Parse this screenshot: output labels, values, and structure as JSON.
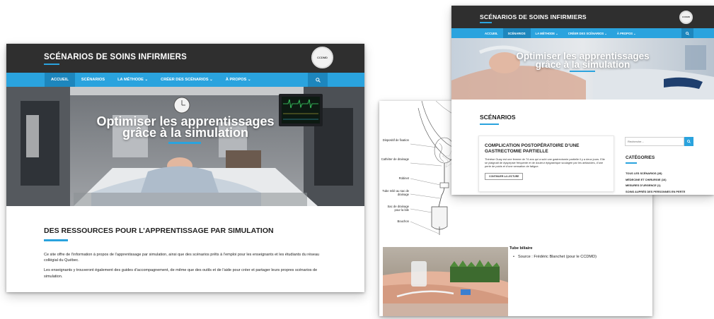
{
  "site": {
    "title": "SCÉNARIOS DE SOINS INFIRMIERS",
    "logo_text": "CCDMD"
  },
  "nav": {
    "items": [
      "ACCUEIL",
      "SCÉNARIOS",
      "LA MÉTHODE ⌄",
      "CRÉER DES SCÉNARIOS ⌄",
      "À PROPOS ⌄"
    ],
    "active_home": 0,
    "active_scenarios": 1
  },
  "hero": {
    "line1": "Optimiser les apprentissages",
    "line2": "grâce à la simulation"
  },
  "home": {
    "heading": "DES RESSOURCES POUR L’APPRENTISSAGE PAR SIMULATION",
    "para1": "Ce site offre de l’information à propos de l’apprentissage par simulation, ainsi que des scénarios prêts à l’emploi pour les enseignants et les étudiants du réseau collégial du Québec.",
    "para2": "Les enseignants y trouveront également des guides d’accompagnement, de même que des outils et de l’aide pour créer et partager leurs propres scénarios de simulation."
  },
  "detail": {
    "diagram_labels": [
      "Dispositif de fixation",
      "Cathéter de drainage",
      "Robinet",
      "Tube relié au sac de drainage",
      "Sac de drainage pour la bile",
      "Bouchon"
    ],
    "tube_title": "Tube biliaire",
    "tube_source": "Source : Frédéric Blanchet (pour le CCDMD)"
  },
  "scenarios": {
    "heading": "SCÉNARIOS",
    "card_title": "COMPLICATION POSTOPÉRATOIRE D’UNE GASTRECTOMIE PARTIELLE",
    "card_text": "Thérèse Guay est une femme de 74 ans qui a subi une gastrectomie partielle il y a deux jours. Elle se plaignait de dyspepsie fréquente et de douleur épigastrique soulagée par les antiacides, d’une perte de poids et d’une sensation de fatigue.",
    "card_button": "CONTINUER LA LECTURE",
    "search_placeholder": "Recherche…",
    "categories_heading": "CATÉGORIES",
    "categories": [
      "TOUS LES SCÉNARIOS (28)",
      "MÉDECINE ET CHIRURGIE (16)",
      "MESURES D’URGENCE (1)",
      "SOINS AUPRÈS DES PERSONNES EN PERTE"
    ]
  },
  "colors": {
    "topbar": "#2f2f2f",
    "nav": "#2aa3de",
    "nav_active": "#1d86bd",
    "accent": "#2aa3de"
  },
  "icons": {
    "search": "search-icon",
    "logo": "ccdmd-logo-icon"
  }
}
